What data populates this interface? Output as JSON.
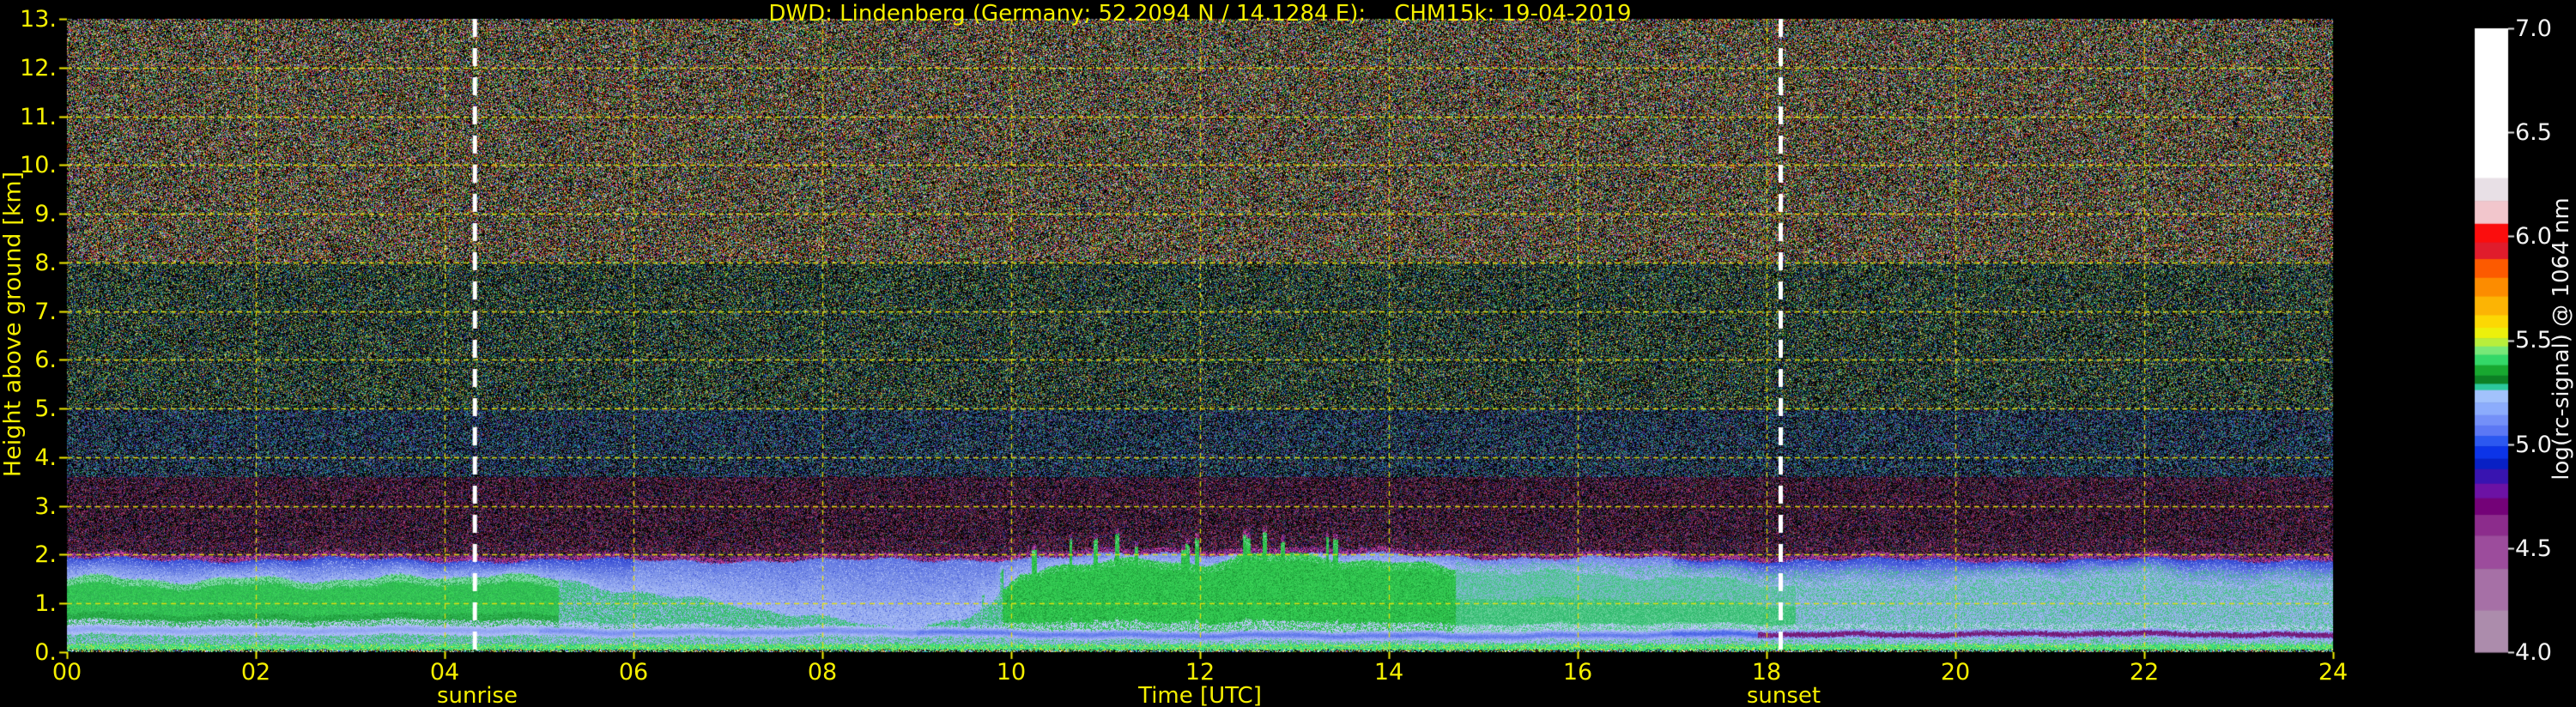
{
  "figure": {
    "background": "#000000",
    "accent_yellow": "#f5ef00"
  },
  "chart_data": {
    "type": "heatmap",
    "title": "DWD: Lindenberg (Germany; 52.2094 N / 14.1284 E):    CHM15k: 19-04-2019",
    "xlabel": "Time [UTC]",
    "ylabel": "Height above ground [km]",
    "x_ticks": [
      "00",
      "02",
      "04",
      "06",
      "08",
      "10",
      "12",
      "14",
      "16",
      "18",
      "20",
      "22",
      "24"
    ],
    "x_range_hours": [
      0,
      24
    ],
    "y_ticks": [
      "13.",
      "12.",
      "11.",
      "10.",
      "9.",
      "8.",
      "7.",
      "6.",
      "5.",
      "4.",
      "3.",
      "2.",
      "1.",
      "0."
    ],
    "y_range_km": [
      0,
      13
    ],
    "grid_on": true,
    "grid_color": "#e8e20a",
    "tick_label_color": "#f5ef00",
    "annotations": {
      "sunrise": {
        "label": "sunrise",
        "hour_utc": 4.32
      },
      "sunset": {
        "label": "sunset",
        "hour_utc": 18.15
      }
    },
    "colorbar": {
      "label": "log(rc-signal) @ 1064 nm",
      "ticks": [
        "7.0",
        "6.5",
        "6.0",
        "5.5",
        "5.0",
        "4.5",
        "4.0"
      ],
      "range": [
        4.0,
        7.0
      ],
      "stops": [
        [
          7.0,
          "#ffffff"
        ],
        [
          6.28,
          "#e8e0e6"
        ],
        [
          6.17,
          "#f2c6cc"
        ],
        [
          6.06,
          "#fb0d0d"
        ],
        [
          5.97,
          "#e01c2c"
        ],
        [
          5.89,
          "#fc5a00"
        ],
        [
          5.8,
          "#fc8c00"
        ],
        [
          5.71,
          "#fcb404"
        ],
        [
          5.62,
          "#fcd804"
        ],
        [
          5.56,
          "#ecf00c"
        ],
        [
          5.51,
          "#b8ee3c"
        ],
        [
          5.47,
          "#78e878"
        ],
        [
          5.43,
          "#34d868"
        ],
        [
          5.38,
          "#18a830"
        ],
        [
          5.33,
          "#0c8024"
        ],
        [
          5.29,
          "#2cc89c"
        ],
        [
          5.26,
          "#a2c2fc"
        ],
        [
          5.2,
          "#8cacfc"
        ],
        [
          5.14,
          "#7490f8"
        ],
        [
          5.09,
          "#5c78f4"
        ],
        [
          5.04,
          "#2c58f0"
        ],
        [
          4.99,
          "#0c34e8"
        ],
        [
          4.93,
          "#0820c4"
        ],
        [
          4.88,
          "#3814b0"
        ],
        [
          4.81,
          "#6c12a4"
        ],
        [
          4.74,
          "#740278"
        ],
        [
          4.66,
          "#8c2c8c"
        ],
        [
          4.56,
          "#9c4c9c"
        ],
        [
          4.4,
          "#a670a6"
        ],
        [
          4.2,
          "#ac8cac"
        ],
        [
          4.0,
          "#ac8cac"
        ]
      ]
    },
    "mixing_layer_top_km": [
      [
        0,
        1.5
      ],
      [
        1,
        1.5
      ],
      [
        2,
        1.55
      ],
      [
        3,
        1.5
      ],
      [
        4,
        1.5
      ],
      [
        4.5,
        1.6
      ],
      [
        5,
        1.5
      ],
      [
        5.5,
        1.42
      ],
      [
        6,
        1.3
      ],
      [
        6.5,
        1.12
      ],
      [
        7,
        1.05
      ],
      [
        7.5,
        0.85
      ],
      [
        8,
        0.65
      ],
      [
        8.5,
        0.52
      ],
      [
        9,
        0.55
      ],
      [
        9.5,
        0.62
      ],
      [
        9.8,
        1.0
      ],
      [
        10.1,
        1.65
      ],
      [
        10.4,
        1.85
      ],
      [
        11,
        1.88
      ],
      [
        11.5,
        1.92
      ],
      [
        12,
        1.82
      ],
      [
        12.5,
        1.95
      ],
      [
        13,
        1.98
      ],
      [
        13.5,
        1.92
      ],
      [
        14,
        1.85
      ],
      [
        14.5,
        1.78
      ],
      [
        15,
        1.72
      ],
      [
        15.5,
        1.68
      ],
      [
        16,
        1.62
      ],
      [
        16.5,
        1.58
      ],
      [
        17,
        1.5
      ],
      [
        17.5,
        1.45
      ],
      [
        18,
        1.4
      ],
      [
        19,
        1.35
      ],
      [
        20,
        1.42
      ],
      [
        21,
        1.48
      ],
      [
        21.8,
        1.52
      ],
      [
        22.5,
        1.38
      ],
      [
        23,
        1.35
      ],
      [
        24,
        1.35
      ]
    ],
    "noise_floor_km": [
      [
        0,
        2.03
      ],
      [
        6,
        2.0
      ],
      [
        9,
        2.0
      ],
      [
        11,
        2.1
      ],
      [
        12.5,
        2.15
      ],
      [
        14,
        2.1
      ],
      [
        17,
        2.02
      ],
      [
        20,
        2.0
      ],
      [
        24,
        2.02
      ]
    ],
    "low_band_center_km": [
      [
        0,
        0.46
      ],
      [
        4,
        0.45
      ],
      [
        6,
        0.42
      ],
      [
        9,
        0.42
      ],
      [
        12,
        0.34
      ],
      [
        15,
        0.34
      ],
      [
        18,
        0.37
      ],
      [
        21,
        0.38
      ],
      [
        24,
        0.36
      ]
    ],
    "description": "Ceilometer quicklook: aerosol backscatter signal below ~2 km, uncorrelated photon-count noise above; sunrise/sunset marked by white dashed lines."
  }
}
